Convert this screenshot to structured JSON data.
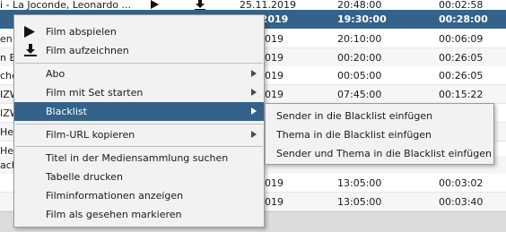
{
  "table": {
    "rows": [
      {
        "title": "i - La Joconde, Leonardo ...",
        "date": "25.11.2019",
        "time": "20:48:00",
        "duration": "00:02:58"
      },
      {
        "title": "",
        "date": ".11.2019",
        "time": "19:30:00",
        "duration": "00:28:00"
      },
      {
        "title": "en l",
        "date": ".11.2019",
        "time": "20:10:00",
        "duration": "00:06:09"
      },
      {
        "title": "n Bl",
        "date": ".11.2019",
        "time": "00:20:00",
        "duration": "00:26:05"
      },
      {
        "title": "che",
        "date": ".11.2019",
        "time": "00:05:00",
        "duration": "00:26:05"
      },
      {
        "title": "IZW",
        "date": ".11.2019",
        "time": "07:45:00",
        "duration": "00:15:22"
      },
      {
        "title": "IZW",
        "date": "",
        "time": "",
        "duration": ""
      },
      {
        "title": "He",
        "date": "",
        "time": "",
        "duration": ""
      },
      {
        "title": "He",
        "date": "",
        "time": "",
        "duration": ""
      },
      {
        "title": "ach",
        "date": "",
        "time": "",
        "duration": ""
      },
      {
        "title": "",
        "date": ".11.2019",
        "time": "13:05:00",
        "duration": "00:03:02"
      },
      {
        "title": "",
        "date": ".11.2019",
        "time": "13:05:00",
        "duration": "00:03:40"
      }
    ]
  },
  "menu": {
    "play": "Film abspielen",
    "record": "Film aufzeichnen",
    "abo": "Abo",
    "start_with_set": "Film mit Set starten",
    "blacklist": "Blacklist",
    "copy_url": "Film-URL kopieren",
    "search_title": "Titel in der Mediensammlung suchen",
    "print_table": "Tabelle drucken",
    "film_info": "Filminformationen anzeigen",
    "mark_seen": "Film als gesehen markieren"
  },
  "submenu": {
    "add_sender": "Sender in die Blacklist einfügen",
    "add_thema": "Thema in die Blacklist einfügen",
    "add_sender_thema": "Sender und Thema in die Blacklist einfügen"
  },
  "icons": {
    "play": "play-icon",
    "download": "download-icon",
    "submenu_arrow": "chevron-right-icon"
  },
  "colors": {
    "selection": "#35628a",
    "menu_bg": "#f2f2f2"
  }
}
